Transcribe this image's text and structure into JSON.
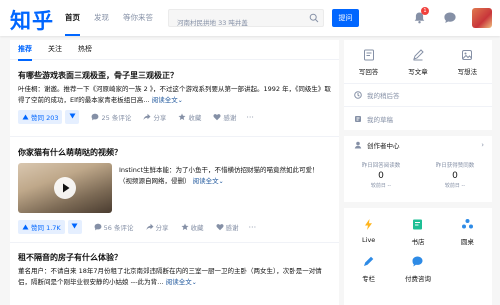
{
  "header": {
    "logo": "知乎",
    "nav": [
      "首页",
      "发现",
      "等你来答"
    ],
    "search_placeholder": "河南村民拱地 33 吨井盖",
    "ask_label": "提问",
    "notification_count": "1"
  },
  "feed": {
    "tabs": [
      "推荐",
      "关注",
      "热榜"
    ],
    "items": [
      {
        "title": "有哪些游戏表面三观极歪，骨子里三观极正？",
        "excerpt": "叶佳桐：谢邀。推荐一下《河原崎家的一族 2 》，不过这个游戏系列要从第一部讲起。1992 年，《同级生》取得了空前的成功，Elf的最本家青老板组日高…",
        "more": "阅读全文",
        "vote": "赞同 203",
        "comments": "25 条评论",
        "share": "分享",
        "collect": "收藏",
        "thanks": "感谢"
      },
      {
        "title": "你家猫有什么萌萌哒的视频？",
        "excerpt": "Instinct生鲜本能：为了小鱼干，不惜横仿招财猫的喵竟然如此可爱！（视频源自网络，侵删）",
        "more": "阅读全文",
        "vote": "赞同 1.7K",
        "comments": "56 条评论",
        "share": "分享",
        "collect": "收藏",
        "thanks": "感谢"
      },
      {
        "title": "租不隔音的房子有什么体验？",
        "excerpt": "董名用户：不请自来 18年7月份租了北京南郊违隔断在内的三室一厨一卫的主卧（两女生），次卧是一对情侣，隔断间是个刚毕业很安静的小姑娘 ---此为背…",
        "more": "阅读全文"
      }
    ]
  },
  "sidebar": {
    "write": [
      "写回答",
      "写文章",
      "写想法"
    ],
    "links": [
      "我的稍后答",
      "我的草稿"
    ],
    "creator": {
      "title": "创作者中心",
      "stats": [
        {
          "label": "昨日回答阅读数",
          "value": "0",
          "change": "较前日 --"
        },
        {
          "label": "昨日获得赞同数",
          "value": "0",
          "change": "较前日 --"
        }
      ]
    },
    "grid": [
      "Live",
      "书店",
      "圆桌",
      "专栏",
      "付费咨询"
    ]
  },
  "colors": {
    "brand": "#0066ff",
    "text": "#121212",
    "muted": "#8590a6",
    "link": "#175199",
    "page_bg": "#f6f6f6"
  }
}
